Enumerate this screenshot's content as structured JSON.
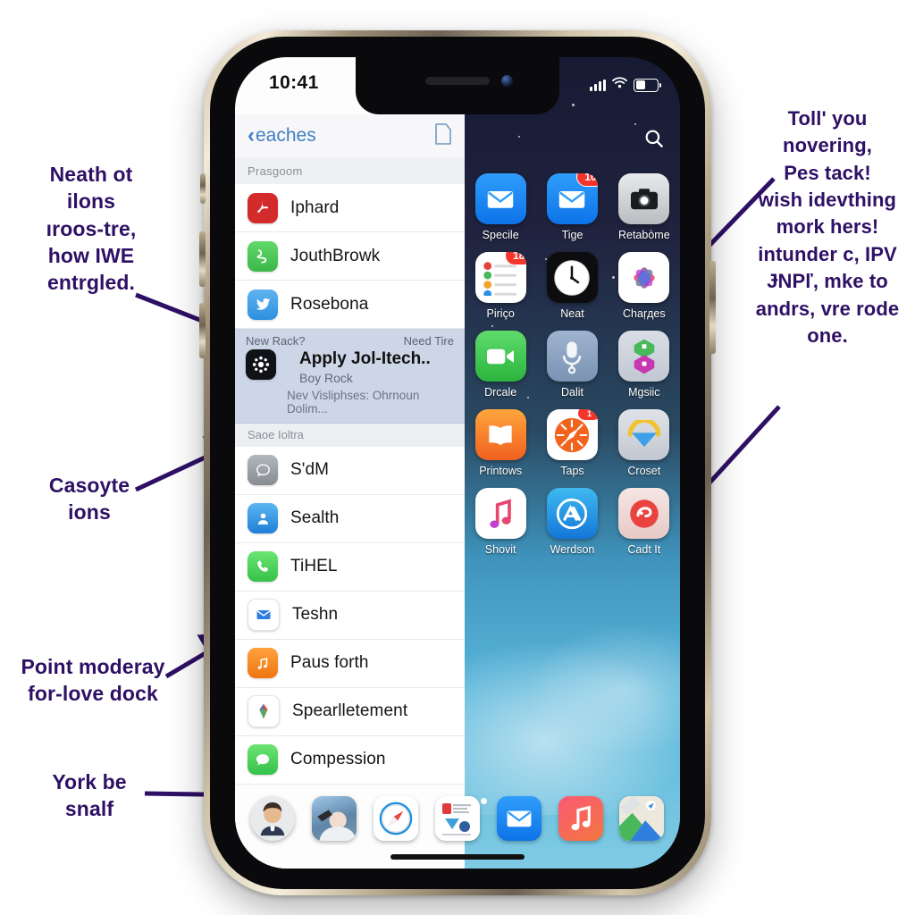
{
  "status_bar": {
    "time": "10:41",
    "signal_icon": "cellular-signal-icon",
    "wifi_icon": "wifi-icon",
    "battery_icon": "battery-icon"
  },
  "left_pane": {
    "nav": {
      "back_label": "eaches",
      "back_chevron": "‹",
      "right_icon": "document-icon"
    },
    "section_header": "Prasgoom",
    "section_header_2": "Saoe Ioltra",
    "rows_top": [
      {
        "label": "Iphard",
        "icon": "adobe-acrobat-icon",
        "color": "#d32b2b"
      },
      {
        "label": "JouthBrowk",
        "icon": "health-activity-icon",
        "color": "#46c455"
      },
      {
        "label": "Rosebona",
        "icon": "twitter-bird-icon",
        "color": "#4aa3e8"
      }
    ],
    "highlighted": {
      "top_left": "New Rack?",
      "top_right": "Need Tire",
      "title": "Apply Jol-Itech..",
      "subtitle": "Boy Rock",
      "footer": "Nev Visliphses:  Ohrnoun Dolim...",
      "icon": "settings-gear-dark-icon"
    },
    "rows_bottom": [
      {
        "label": "S'dM",
        "icon": "chat-bubble-gray-icon",
        "color": "#9aa0a6"
      },
      {
        "label": "Sealth",
        "icon": "contacts-person-icon",
        "color": "#2d8fe8"
      },
      {
        "label": "TiHEL",
        "icon": "phone-handset-icon",
        "color": "#4cd25d"
      },
      {
        "label": "Teshn",
        "icon": "mail-envelope-icon",
        "color": "#ffffff"
      },
      {
        "label": "Paus forth",
        "icon": "music-note-orange-icon",
        "color": "#f0821e"
      },
      {
        "label": "Spearlletement",
        "icon": "colorful-app-icon",
        "color": "#ffffff"
      },
      {
        "label": "Compession",
        "icon": "messages-bubble-icon",
        "color": "#4cd25d"
      }
    ]
  },
  "right_pane": {
    "search_icon": "search-icon",
    "apps": [
      {
        "name": "Specile",
        "icon": "mail-envelope-icon",
        "badge": ""
      },
      {
        "name": "Tige",
        "icon": "mail-envelope-icon",
        "badge": "10"
      },
      {
        "name": "Retabòme",
        "icon": "camera-icon",
        "badge": ""
      },
      {
        "name": "Piriço",
        "icon": "reminders-list-icon",
        "badge": "18"
      },
      {
        "name": "Neat",
        "icon": "clock-icon",
        "badge": ""
      },
      {
        "name": "Chaŗдes",
        "icon": "photos-flower-icon",
        "badge": ""
      },
      {
        "name": "Drcale",
        "icon": "facetime-video-icon",
        "badge": ""
      },
      {
        "name": "Dalit",
        "icon": "microphone-icon",
        "badge": ""
      },
      {
        "name": "Mgsiic",
        "icon": "shortcuts-icon",
        "badge": ""
      },
      {
        "name": "Printows",
        "icon": "books-open-icon",
        "badge": ""
      },
      {
        "name": "Taps",
        "icon": "safari-compass-orange-icon",
        "badge": "1"
      },
      {
        "name": "Croset",
        "icon": "download-arrow-icon",
        "badge": ""
      },
      {
        "name": "Shovit",
        "icon": "music-note-pink-icon",
        "badge": ""
      },
      {
        "name": "Werdson",
        "icon": "app-store-icon",
        "badge": ""
      },
      {
        "name": "Cadt It",
        "icon": "red-circle-app-icon",
        "badge": ""
      }
    ],
    "page_dots": {
      "count": 2,
      "active_index": 1
    }
  },
  "dock": {
    "items": [
      {
        "icon": "memoji-avatar-icon"
      },
      {
        "icon": "photo-thumbnail-icon"
      },
      {
        "icon": "safari-compass-icon"
      },
      {
        "icon": "document-app-icon"
      },
      {
        "icon": "mail-envelope-icon"
      },
      {
        "icon": "music-note-icon"
      },
      {
        "icon": "maps-icon"
      }
    ],
    "home_indicator": "home-bar"
  },
  "annotations": {
    "left_top": "Neath ot\nilons\nıroos-tre,\nhow IWE\nentrgled.",
    "left_mid": "Casoyte\nions",
    "left_low": "Point moderay\nfor-love dock",
    "left_bottom": "York be\nsnalf",
    "right": "Toll' you\nnovering,\nPes tack!\nwish idevthing\nmork hers!\nintunder c, IPV\nɈNPľ, mke to\nandrs, vre rode\none.",
    "color": "#2e1065"
  }
}
